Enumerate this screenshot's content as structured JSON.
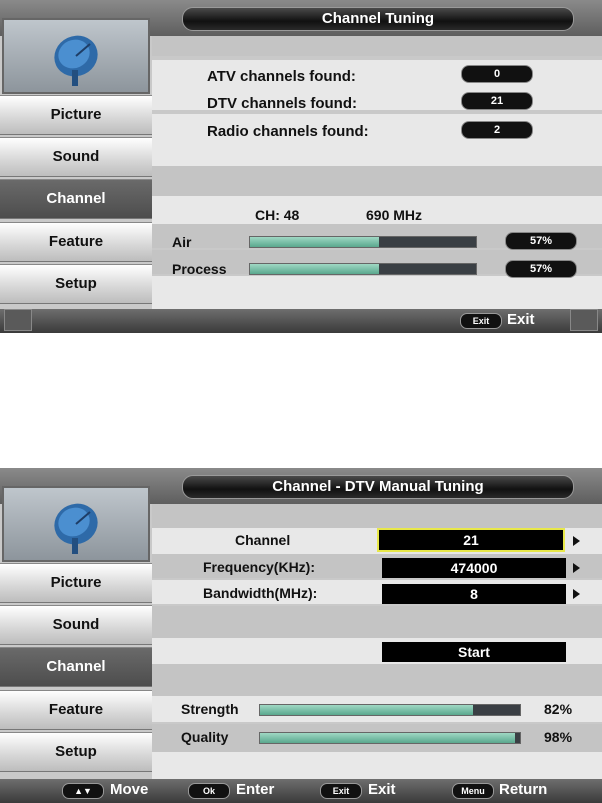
{
  "screen1": {
    "title": "Channel Tuning",
    "menu": [
      "Picture",
      "Sound",
      "Channel",
      "Feature",
      "Setup"
    ],
    "active_menu": "Channel",
    "atv_label": "ATV channels found:",
    "atv_value": "0",
    "dtv_label": "DTV channels found:",
    "dtv_value": "21",
    "radio_label": "Radio channels found:",
    "radio_value": "2",
    "ch_label": "CH: 48",
    "freq_label": "690 MHz",
    "air_label": "Air",
    "air_percent": "57%",
    "air_level": 0.57,
    "process_label": "Process",
    "process_percent": "57%",
    "process_level": 0.57,
    "exit_key": "Exit",
    "exit_label": "Exit"
  },
  "screen2": {
    "title": "Channel - DTV Manual Tuning",
    "menu": [
      "Picture",
      "Sound",
      "Channel",
      "Feature",
      "Setup"
    ],
    "active_menu": "Channel",
    "channel_label": "Channel",
    "channel_value": "21",
    "frequency_label": "Frequency(KHz):",
    "frequency_value": "474000",
    "bandwidth_label": "Bandwidth(MHz):",
    "bandwidth_value": "8",
    "start_label": "Start",
    "strength_label": "Strength",
    "strength_percent": "82%",
    "strength_level": 0.82,
    "quality_label": "Quality",
    "quality_percent": "98%",
    "quality_level": 0.98,
    "move_key": "▲▼",
    "move_label": "Move",
    "ok_key": "Ok",
    "enter_label": "Enter",
    "exit_key": "Exit",
    "exit_label": "Exit",
    "menu_key": "Menu",
    "return_label": "Return"
  },
  "icon": "satellite-dish-icon",
  "colors": {
    "bar_fill": "#7cc4ad",
    "highlight": "#e8e84a",
    "active_menu": "#555555"
  }
}
